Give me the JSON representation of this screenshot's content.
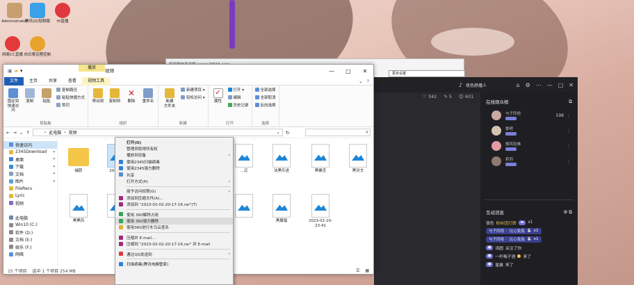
{
  "desktop": {
    "icons": [
      {
        "label": "Administrator",
        "color": "#c8a070"
      },
      {
        "label": "腾讯QQ轻聊版",
        "color": "#3aa0e8"
      },
      {
        "label": "Hi直播",
        "color": "#e0383e"
      },
      {
        "label": "网易CC直播",
        "color": "#e23a3a"
      },
      {
        "label": "向日葵远程控制",
        "color": "#e8a42a"
      }
    ]
  },
  "background_window": {
    "title": "修改微信发送框/ www.7F555.com",
    "field": "更多设置"
  },
  "explorer": {
    "title": "视频",
    "context_tab_head": "播放",
    "quick_access_icons": [
      "save-icon",
      "folder-icon",
      "dropdown-icon"
    ],
    "tabs": [
      "文件",
      "主页",
      "共享",
      "查看",
      "视频工具"
    ],
    "ribbon": {
      "clipboard": {
        "name": "剪贴板",
        "pin": "固定到快速访问",
        "copy": "复制",
        "paste": "粘贴",
        "copy_path": "复制路径",
        "paste_shortcut": "粘贴快捷方式",
        "cut": "剪切"
      },
      "organize": {
        "name": "组织",
        "move_to": "移动到",
        "copy_to": "复制到",
        "delete": "删除",
        "rename": "重命名"
      },
      "new": {
        "name": "新建",
        "new_folder": "新建\n文件夹",
        "new_item": "新建项目 ▾",
        "easy_access": "轻松访问 ▾"
      },
      "open": {
        "name": "打开",
        "properties": "属性",
        "open": "打开 ▾",
        "edit": "编辑",
        "history": "历史记录"
      },
      "select": {
        "name": "选择",
        "select_all": "全部选择",
        "select_none": "全部取消",
        "invert": "反向选择"
      }
    },
    "address": {
      "path": [
        "此电脑",
        "视频"
      ],
      "search_icon": "search-icon"
    },
    "nav": [
      {
        "label": "快速访问",
        "selected": true,
        "pin": false
      },
      {
        "label": "2345Download",
        "selected": false,
        "pin": true
      },
      {
        "label": "桌面",
        "selected": false,
        "pin": true
      },
      {
        "label": "下载",
        "selected": false,
        "pin": true
      },
      {
        "label": "文档",
        "selected": false,
        "pin": true
      },
      {
        "label": "图片",
        "selected": false,
        "pin": true
      },
      {
        "label": "FileRecv",
        "selected": false,
        "pin": false
      },
      {
        "label": "Lyric",
        "selected": false,
        "pin": false
      },
      {
        "label": "视频",
        "selected": false,
        "pin": false
      },
      {
        "label": "",
        "selected": false,
        "pin": false
      },
      {
        "label": "此电脑",
        "selected": false,
        "pin": false
      },
      {
        "label": "Win10 (C:)",
        "selected": false,
        "pin": false
      },
      {
        "label": "软件 (D:)",
        "selected": false,
        "pin": false
      },
      {
        "label": "文档 (E:)",
        "selected": false,
        "pin": false
      },
      {
        "label": "娱乐 (F:)",
        "selected": false,
        "pin": false
      },
      {
        "label": "网络",
        "selected": false,
        "pin": false
      }
    ],
    "files": [
      {
        "name": "捕获",
        "kind": "folder"
      },
      {
        "name": "2023-0\n1",
        "kind": "video",
        "selected": true
      },
      {
        "name": "...泛",
        "kind": "video"
      },
      {
        "name": "法黑乐进",
        "kind": "video"
      },
      {
        "name": "黑暴舌",
        "kind": "video"
      },
      {
        "name": "黑对文",
        "kind": "video"
      },
      {
        "name": "黑黑风",
        "kind": "video"
      },
      {
        "name": "",
        "kind": "video"
      },
      {
        "name": "",
        "kind": "video"
      },
      {
        "name": "黑属暗",
        "kind": "video"
      },
      {
        "name": "2023-02-20-\n23-41",
        "kind": "video"
      }
    ],
    "status": {
      "count": "15 个项目",
      "selected": "选中 1 个项目 254 MB"
    }
  },
  "context_menu": {
    "items": [
      {
        "label": "打开(O)",
        "bold": true,
        "arrow": false,
        "color": ""
      },
      {
        "label": "管理员取得所有权",
        "bold": false,
        "arrow": false,
        "color": ""
      },
      {
        "label": "播放到设备",
        "bold": false,
        "arrow": true,
        "color": ""
      },
      {
        "label": "使用2345扫描病毒",
        "bold": false,
        "arrow": false,
        "color": "#2f7fd8"
      },
      {
        "label": "使用2345强力删除",
        "bold": false,
        "arrow": false,
        "color": "#2f7fd8"
      },
      {
        "label": "共享",
        "bold": false,
        "arrow": false,
        "color": "#5a8ad0"
      },
      {
        "label": "打开方式(H)",
        "bold": false,
        "arrow": true,
        "color": ""
      },
      {
        "sep": true
      },
      {
        "label": "授予访问权限(G)",
        "bold": false,
        "arrow": true,
        "color": ""
      },
      {
        "label": "添加到压缩文件(A)...",
        "bold": false,
        "arrow": false,
        "color": "#a02a7a"
      },
      {
        "label": "添加到 \"2023-02-02-20-17-16.rar\"(T)",
        "bold": false,
        "arrow": false,
        "color": "#a02a7a"
      },
      {
        "sep": true
      },
      {
        "label": "使用 360解除占用",
        "bold": false,
        "arrow": false,
        "color": "#33a457"
      },
      {
        "label": "使用 360强力删除",
        "bold": false,
        "arrow": false,
        "color": "#33a457",
        "hover": true
      },
      {
        "label": "使用360进行木马云查杀",
        "bold": false,
        "arrow": false,
        "color": "#e2b02e"
      },
      {
        "sep": true
      },
      {
        "label": "压缩并 E-mail...",
        "bold": false,
        "arrow": false,
        "color": "#a02a7a"
      },
      {
        "label": "压缩到 \"2023-02-02-20-17-16.rar\" 并 E-mail",
        "bold": false,
        "arrow": false,
        "color": "#a02a7a"
      },
      {
        "sep": true
      },
      {
        "label": "通过QQ发送到",
        "bold": false,
        "arrow": true,
        "color": "#e0383e"
      },
      {
        "sep": true
      },
      {
        "label": "扫描病毒(腾讯电脑管家)",
        "bold": false,
        "arrow": false,
        "color": "#2f7fd8"
      }
    ]
  },
  "live_app": {
    "room_label": "夜色颜播人",
    "stats": {
      "views": "342",
      "likes": "5",
      "fans": "601"
    },
    "online": {
      "title": "在线观众榜",
      "users": [
        {
          "name": "与子同袍",
          "value": "598"
        },
        {
          "name": "黎明",
          "value": ""
        },
        {
          "name": "微风轻拂",
          "value": ""
        },
        {
          "name": "莉莉",
          "value": ""
        }
      ]
    },
    "interaction": {
      "title": "互动消息",
      "messages": [
        {
          "kind": "gift",
          "user": "夜色",
          "text": "粉丝团灯牌",
          "count": "x1"
        },
        {
          "kind": "chip",
          "user": "与子同袍",
          "text": "比心兔兔",
          "count": "x1"
        },
        {
          "kind": "chip",
          "user": "与子同袍",
          "text": "比心兔兔",
          "count": "x1"
        },
        {
          "kind": "text",
          "user": "汤圆",
          "text": "关注了你"
        },
        {
          "kind": "text",
          "user": "一杆梅子酒",
          "text": "来了"
        },
        {
          "kind": "text",
          "user": "星晨",
          "text": "来了"
        }
      ]
    }
  }
}
